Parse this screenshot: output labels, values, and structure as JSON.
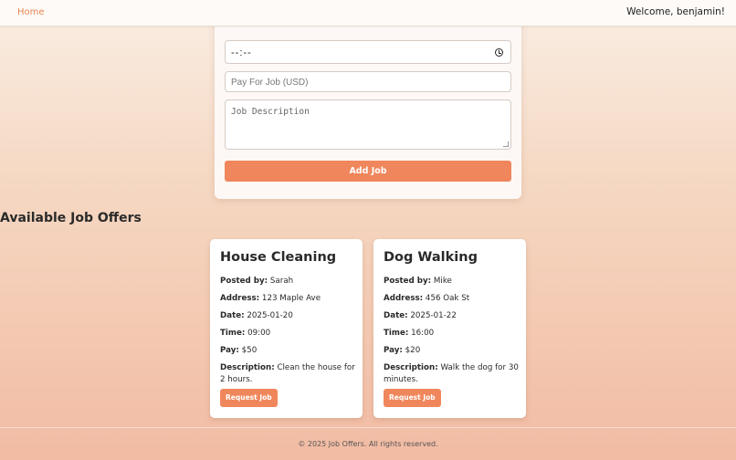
{
  "nav": {
    "home_label": "Home",
    "welcome": "Welcome, benjamin!"
  },
  "form": {
    "time_value": "--:--",
    "pay_placeholder": "Pay For Job (USD)",
    "description_placeholder": "Job Description",
    "submit_label": "Add Job"
  },
  "offers": {
    "heading": "Available Job Offers",
    "labels": {
      "posted_by": "Posted by:",
      "address": "Address:",
      "date": "Date:",
      "time": "Time:",
      "pay": "Pay:",
      "description": "Description:"
    },
    "jobs": [
      {
        "title": "House Cleaning",
        "posted_by": "Sarah",
        "address": "123 Maple Ave",
        "date": "2025-01-20",
        "time": "09:00",
        "pay": "$50",
        "description": "Clean the house for 2 hours.",
        "button": "Request Job"
      },
      {
        "title": "Dog Walking",
        "posted_by": "Mike",
        "address": "456 Oak St",
        "date": "2025-01-22",
        "time": "16:00",
        "pay": "$20",
        "description": "Walk the dog for 30 minutes.",
        "button": "Request Job"
      }
    ]
  },
  "footer": {
    "text": "© 2025 Job Offers. All rights reserved."
  },
  "colors": {
    "accent": "#f0875c",
    "nav_link": "#e98552"
  },
  "icons": {
    "time_field": "clock-icon"
  }
}
